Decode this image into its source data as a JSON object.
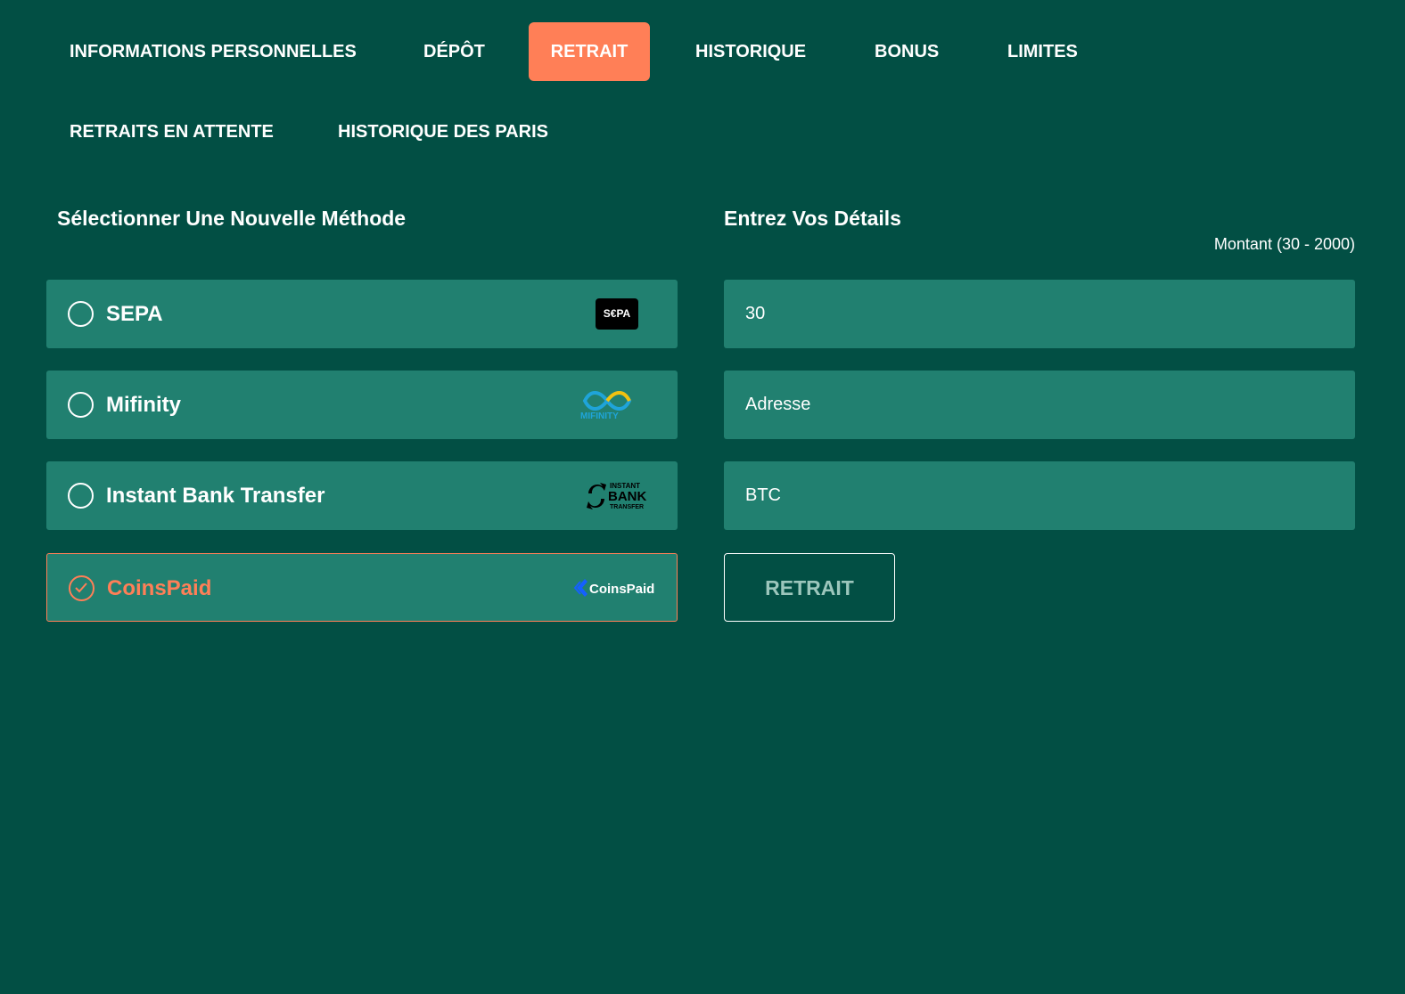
{
  "tabs": [
    {
      "label": "INFORMATIONS PERSONNELLES",
      "active": false
    },
    {
      "label": "DÉPÔT",
      "active": false
    },
    {
      "label": "RETRAIT",
      "active": true
    },
    {
      "label": "HISTORIQUE",
      "active": false
    },
    {
      "label": "BONUS",
      "active": false
    },
    {
      "label": "LIMITES",
      "active": false
    },
    {
      "label": "RETRAITS EN ATTENTE",
      "active": false
    },
    {
      "label": "HISTORIQUE DES PARIS",
      "active": false
    }
  ],
  "methods_section": {
    "title": "Sélectionner Une Nouvelle Méthode",
    "methods": [
      {
        "label": "SEPA",
        "logo": "sepa-logo",
        "logo_text": "S€PA",
        "selected": false
      },
      {
        "label": "Mifinity",
        "logo": "mifinity-logo",
        "logo_text": "MIFINITY",
        "selected": false
      },
      {
        "label": "Instant Bank Transfer",
        "logo": "instant-bank-transfer-logo",
        "logo_text": "INSTANT BANK TRANSFER",
        "selected": false
      },
      {
        "label": "CoinsPaid",
        "logo": "coinspaid-logo",
        "logo_text": "CoinsPaid",
        "selected": true
      }
    ]
  },
  "details_section": {
    "title": "Entrez Vos Détails",
    "amount_range": "Montant (30 - 2000)",
    "amount_value": "30",
    "address_placeholder": "Adresse",
    "currency_value": "BTC",
    "submit_label": "RETRAIT"
  },
  "colors": {
    "background": "#024f44",
    "panel": "#218070",
    "accent": "#ff7f57",
    "text": "#ffffff"
  }
}
